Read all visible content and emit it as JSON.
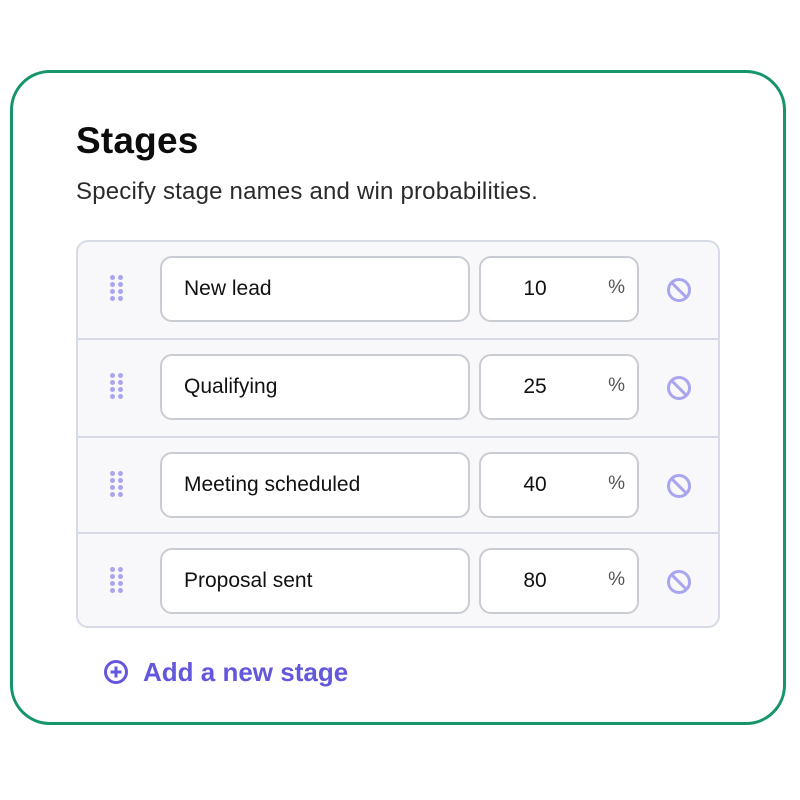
{
  "header": {
    "title": "Stages",
    "subtitle": "Specify stage names and win probabilities."
  },
  "stages": [
    {
      "name": "New lead",
      "probability": "10",
      "unit": "%"
    },
    {
      "name": "Qualifying",
      "probability": "25",
      "unit": "%"
    },
    {
      "name": "Meeting scheduled",
      "probability": "40",
      "unit": "%"
    },
    {
      "name": "Proposal sent",
      "probability": "80",
      "unit": "%"
    }
  ],
  "actions": {
    "add_stage_label": "Add a new stage"
  },
  "colors": {
    "frame_border": "#16956a",
    "accent": "#6358dc",
    "icon_light": "#a9a5ee"
  }
}
